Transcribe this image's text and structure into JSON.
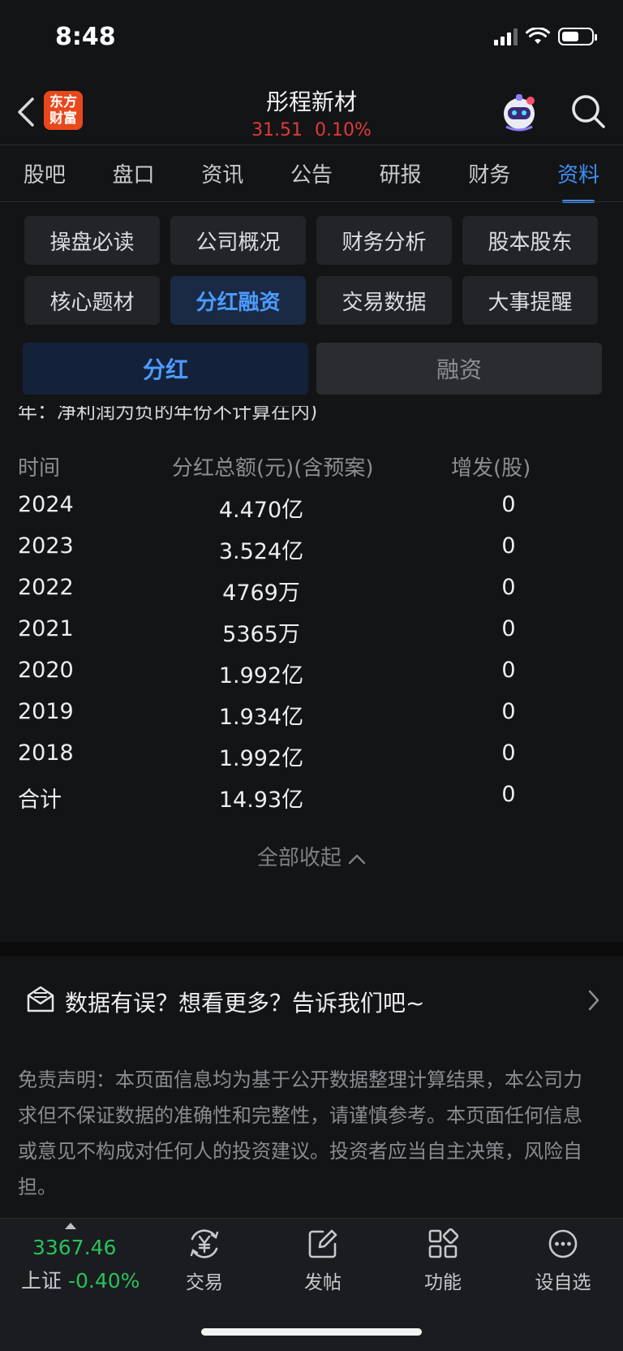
{
  "status": {
    "time": "8:48"
  },
  "header": {
    "logo_text": "东方财富",
    "logo_line1": "东方",
    "logo_line2": "财富",
    "title": "彤程新材",
    "price": "31.51",
    "change_pct": "0.10%"
  },
  "tabs": [
    {
      "label": "股吧"
    },
    {
      "label": "盘口"
    },
    {
      "label": "资讯"
    },
    {
      "label": "公告"
    },
    {
      "label": "研报"
    },
    {
      "label": "财务"
    },
    {
      "label": "资料",
      "active": true
    }
  ],
  "sections": [
    {
      "label": "操盘必读"
    },
    {
      "label": "公司概况"
    },
    {
      "label": "财务分析"
    },
    {
      "label": "股本股东"
    },
    {
      "label": "核心题材"
    },
    {
      "label": "分红融资",
      "active": true
    },
    {
      "label": "交易数据"
    },
    {
      "label": "大事提醒"
    }
  ],
  "segment": {
    "left": "分红",
    "right": "融资"
  },
  "cut_note": "年：净利润为负的年份不计算在内)",
  "table": {
    "headers": [
      "时间",
      "分红总额(元)(含预案)",
      "增发(股)"
    ],
    "rows": [
      [
        "2024",
        "4.470亿",
        "0"
      ],
      [
        "2023",
        "3.524亿",
        "0"
      ],
      [
        "2022",
        "4769万",
        "0"
      ],
      [
        "2021",
        "5365万",
        "0"
      ],
      [
        "2020",
        "1.992亿",
        "0"
      ],
      [
        "2019",
        "1.934亿",
        "0"
      ],
      [
        "2018",
        "1.992亿",
        "0"
      ],
      [
        "合计",
        "14.93亿",
        "0"
      ]
    ]
  },
  "collapse_label": "全部收起",
  "feedback_text": "数据有误？想看更多？告诉我们吧~",
  "disclaimer": "免责声明：本页面信息均为基于公开数据整理计算结果，本公司力求但不保证数据的准确性和完整性，请谨慎参考。本页面任何信息或意见不构成对任何人的投资建议。投资者应当自主决策，风险自担。",
  "bottom": {
    "index_value": "3367.46",
    "index_name": "上证",
    "index_change": "-0.40%",
    "nav": [
      {
        "label": "交易",
        "icon": "yuan-exchange-icon"
      },
      {
        "label": "发帖",
        "icon": "edit-post-icon"
      },
      {
        "label": "功能",
        "icon": "grid-apps-icon"
      },
      {
        "label": "设自选",
        "icon": "more-dots-icon"
      }
    ]
  },
  "colors": {
    "up": "#e03a3a",
    "down": "#27c25c",
    "accent": "#3f8ff5"
  }
}
